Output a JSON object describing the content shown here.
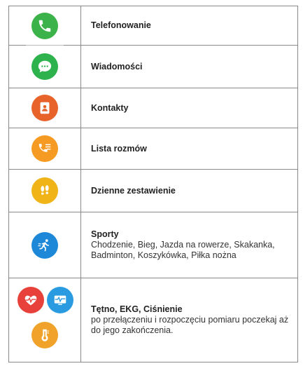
{
  "rows": [
    {
      "title": "Telefonowanie",
      "icon": "phone-icon",
      "color": "#3cb34a"
    },
    {
      "title": "Wiadomości",
      "icon": "message-icon",
      "color": "#2eb24e"
    },
    {
      "title": "Kontakty",
      "icon": "contacts-icon",
      "color": "#e8632a"
    },
    {
      "title": "Lista rozmów",
      "icon": "call-log-icon",
      "color": "#f59a23"
    },
    {
      "title": "Dzienne zestawienie",
      "icon": "footsteps-icon",
      "color": "#f0b419"
    },
    {
      "title": "Sporty",
      "desc": "Chodzenie, Bieg, Jazda na rowerze, Skakanka, Badminton, Koszykówka, Piłka nożna",
      "icon": "running-icon",
      "color": "#1e88d8"
    },
    {
      "title": "Tętno, EKG, Ciśnienie",
      "desc": "po przełączeniu i rozpoczęciu pomiaru poczekaj aż do jego zakończenia.",
      "icons": [
        "heart-rate-icon",
        "ecg-icon",
        "blood-pressure-icon"
      ],
      "colors": [
        "#e8413c",
        "#2a9be0",
        "#f0a22a"
      ]
    }
  ]
}
